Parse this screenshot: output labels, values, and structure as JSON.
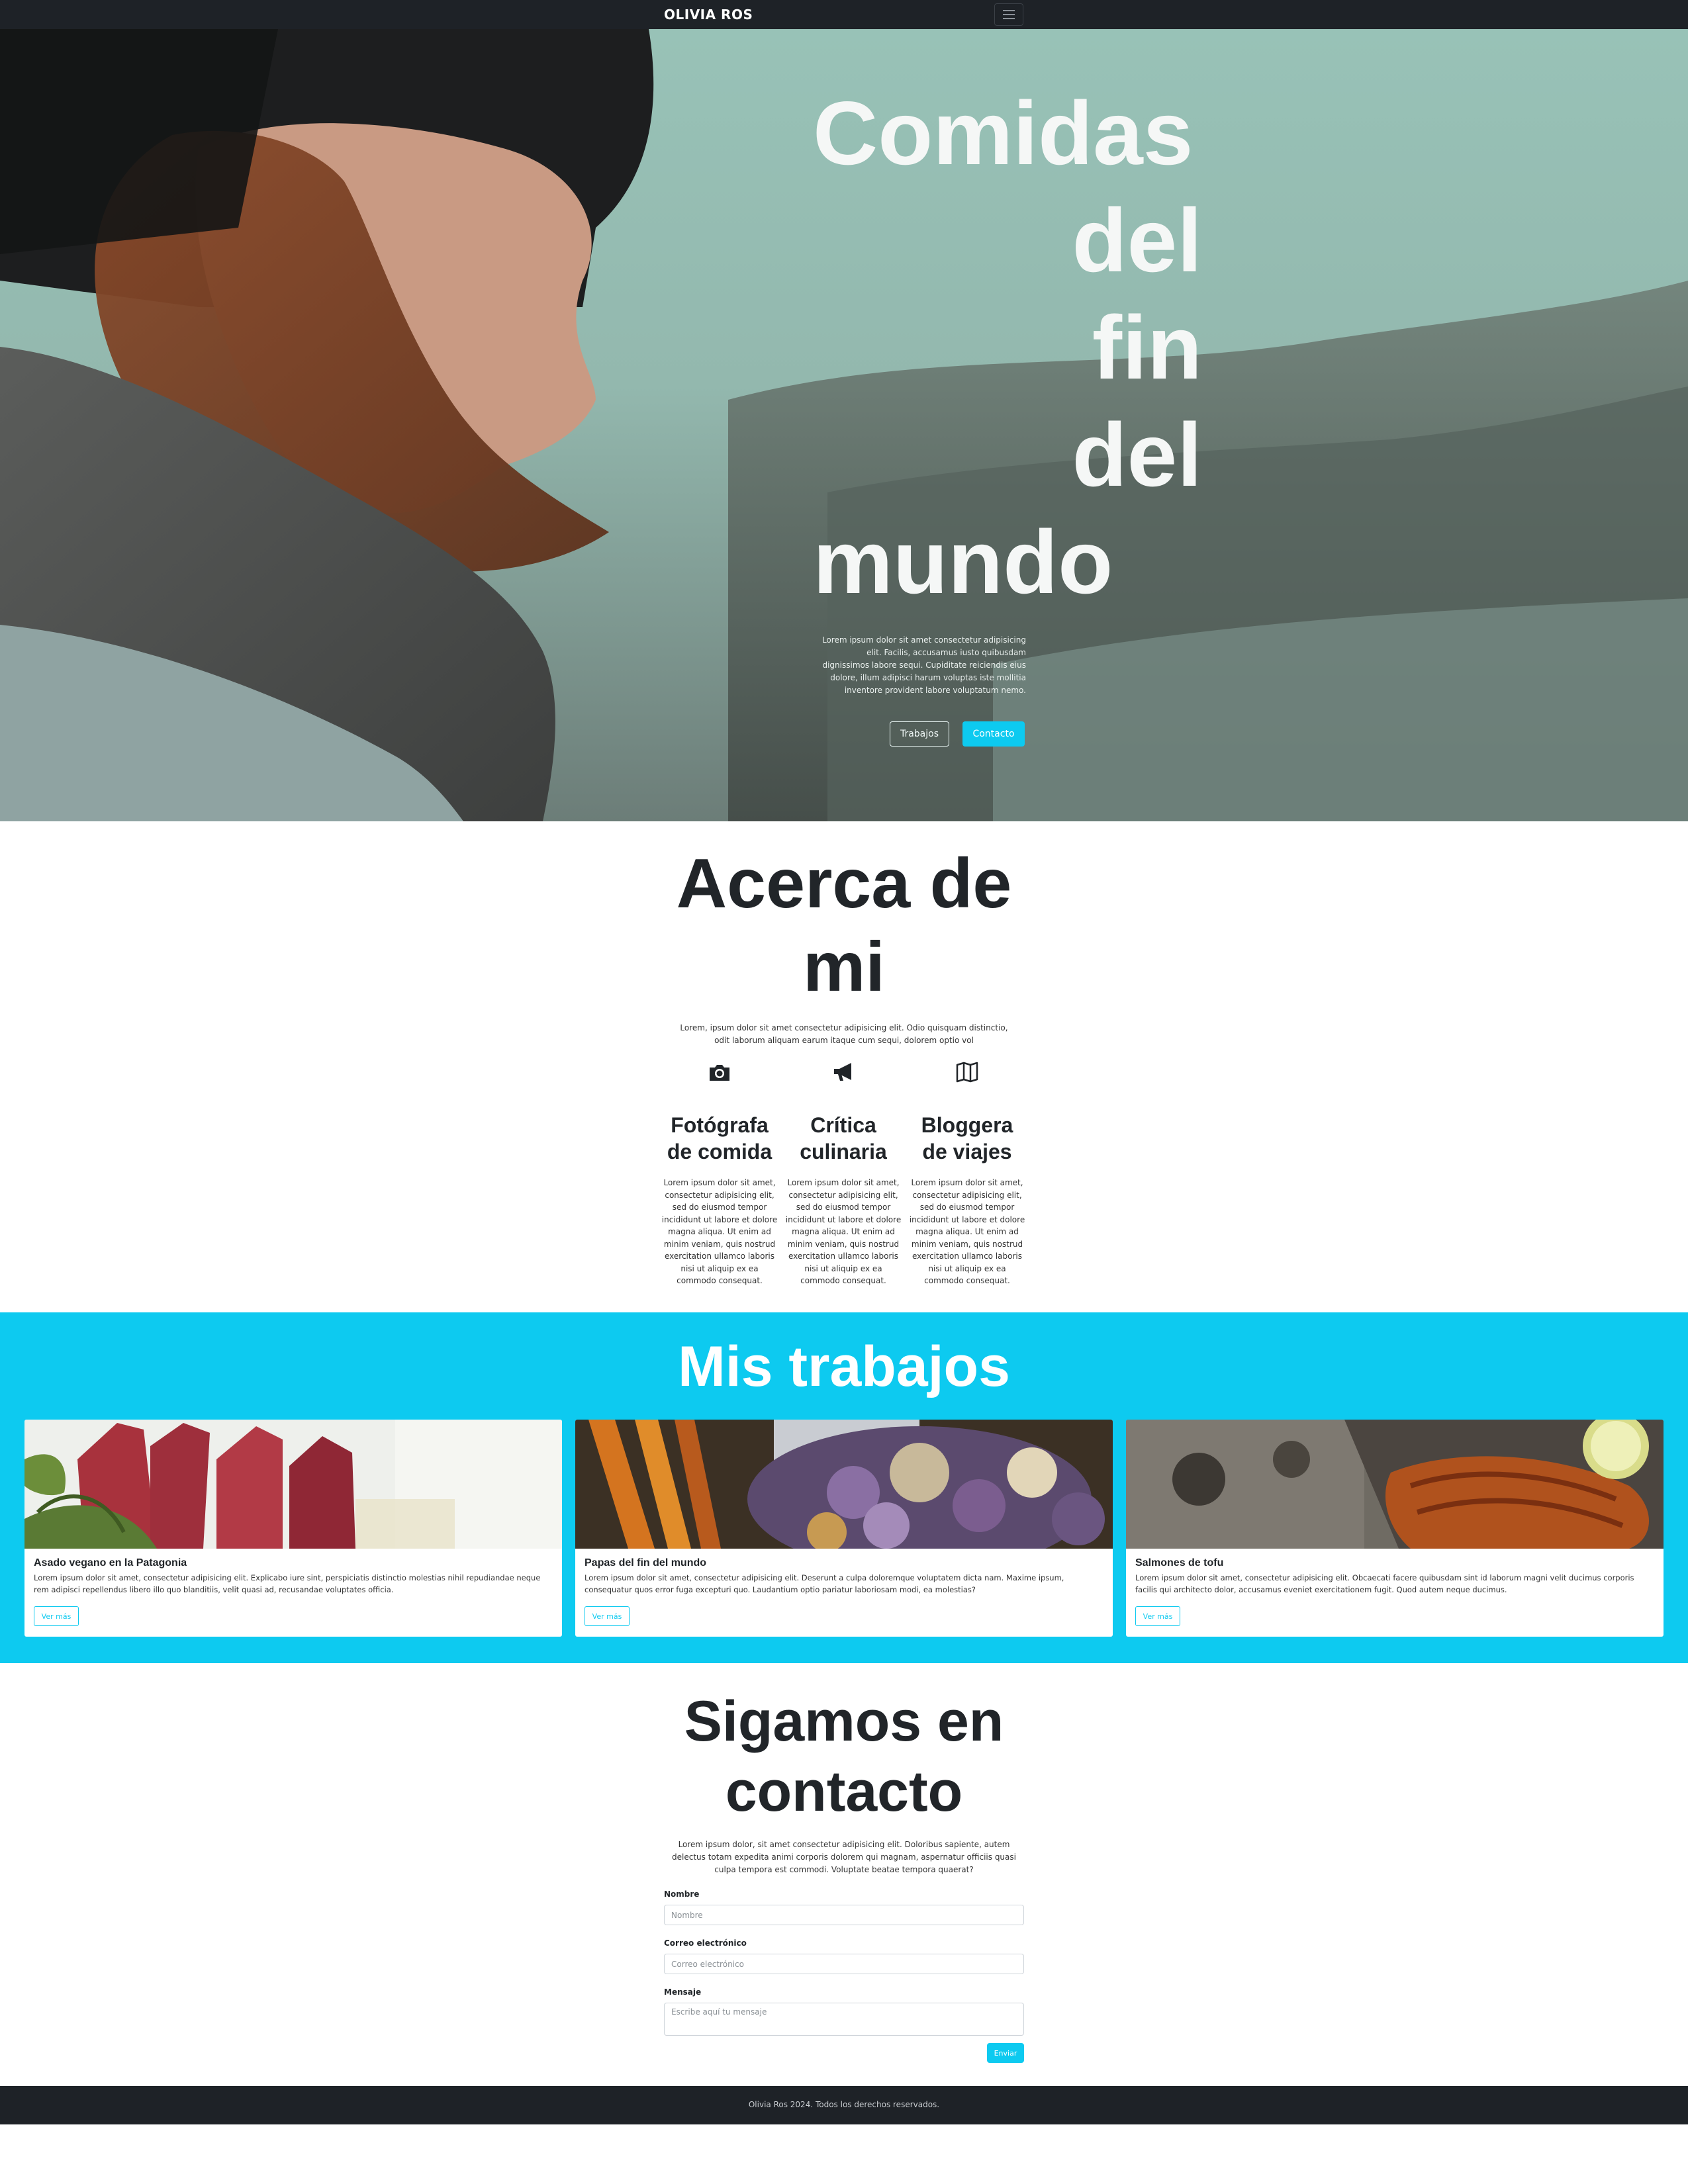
{
  "nav": {
    "brand": "OLIVIA ROS",
    "toggler_icon": "menu-icon"
  },
  "hero": {
    "title_lines": [
      "Comidas",
      "del",
      "fin",
      "del",
      "mundo"
    ],
    "text": "Lorem ipsum dolor sit amet consectetur adipisicing elit. Facilis, accusamus iusto quibusdam dignissimos labore sequi. Cupiditate reiciendis eius dolore, illum adipisci harum voluptas iste mollitia inventore provident labore voluptatum nemo.",
    "btn_works": "Trabajos",
    "btn_contact": "Contacto"
  },
  "about": {
    "title": "Acerca de mi",
    "text": "Lorem, ipsum dolor sit amet consectetur adipisicing elit. Odio quisquam distinctio, odit laborum aliquam earum itaque cum sequi, dolorem optio vol",
    "features": [
      {
        "icon": "camera-icon",
        "title": "Fotógrafa de comida",
        "text": "Lorem ipsum dolor sit amet, consectetur adipisicing elit, sed do eiusmod tempor incididunt ut labore et dolore magna aliqua. Ut enim ad minim veniam, quis nostrud exercitation ullamco laboris nisi ut aliquip ex ea commodo consequat."
      },
      {
        "icon": "megaphone-icon",
        "title": "Crítica culinaria",
        "text": "Lorem ipsum dolor sit amet, consectetur adipisicing elit, sed do eiusmod tempor incididunt ut labore et dolore magna aliqua. Ut enim ad minim veniam, quis nostrud exercitation ullamco laboris nisi ut aliquip ex ea commodo consequat."
      },
      {
        "icon": "map-icon",
        "title": "Bloggera de viajes",
        "text": "Lorem ipsum dolor sit amet, consectetur adipisicing elit, sed do eiusmod tempor incididunt ut labore et dolore magna aliqua. Ut enim ad minim veniam, quis nostrud exercitation ullamco laboris nisi ut aliquip ex ea commodo consequat."
      }
    ]
  },
  "works": {
    "title": "Mis trabajos",
    "cards": [
      {
        "title": "Asado vegano en la Patagonia",
        "text": "Lorem ipsum dolor sit amet, consectetur adipisicing elit. Explicabo iure sint, perspiciatis distinctio molestias nihil repudiandae neque rem adipisci repellendus libero illo quo blanditiis, velit quasi ad, recusandae voluptates officia.",
        "button": "Ver más"
      },
      {
        "title": "Papas del fin del mundo",
        "text": "Lorem ipsum dolor sit amet, consectetur adipisicing elit. Deserunt a culpa doloremque voluptatem dicta nam. Maxime ipsum, consequatur quos error fuga excepturi quo. Laudantium optio pariatur laboriosam modi, ea molestias?",
        "button": "Ver más"
      },
      {
        "title": "Salmones de tofu",
        "text": "Lorem ipsum dolor sit amet, consectetur adipisicing elit. Obcaecati facere quibusdam sint id laborum magni velit ducimus corporis facilis qui architecto dolor, accusamus eveniet exercitationem fugit. Quod autem neque ducimus.",
        "button": "Ver más"
      }
    ]
  },
  "contact": {
    "title": "Sigamos en contacto",
    "text": "Lorem ipsum dolor, sit amet consectetur adipisicing elit. Doloribus sapiente, autem delectus totam expedita animi corporis dolorem qui magnam, aspernatur officiis quasi culpa tempora est commodi. Voluptate beatae tempora quaerat?",
    "name_label": "Nombre",
    "name_placeholder": "Nombre",
    "email_label": "Correo electrónico",
    "email_placeholder": "Correo electrónico",
    "message_label": "Mensaje",
    "message_placeholder": "Escribe aquí tu mensaje",
    "send": "Enviar"
  },
  "footer": {
    "text": "Olivia Ros 2024. Todos los derechos reservados."
  },
  "colors": {
    "accent": "#0dcaf0",
    "dark": "#1e2227"
  }
}
